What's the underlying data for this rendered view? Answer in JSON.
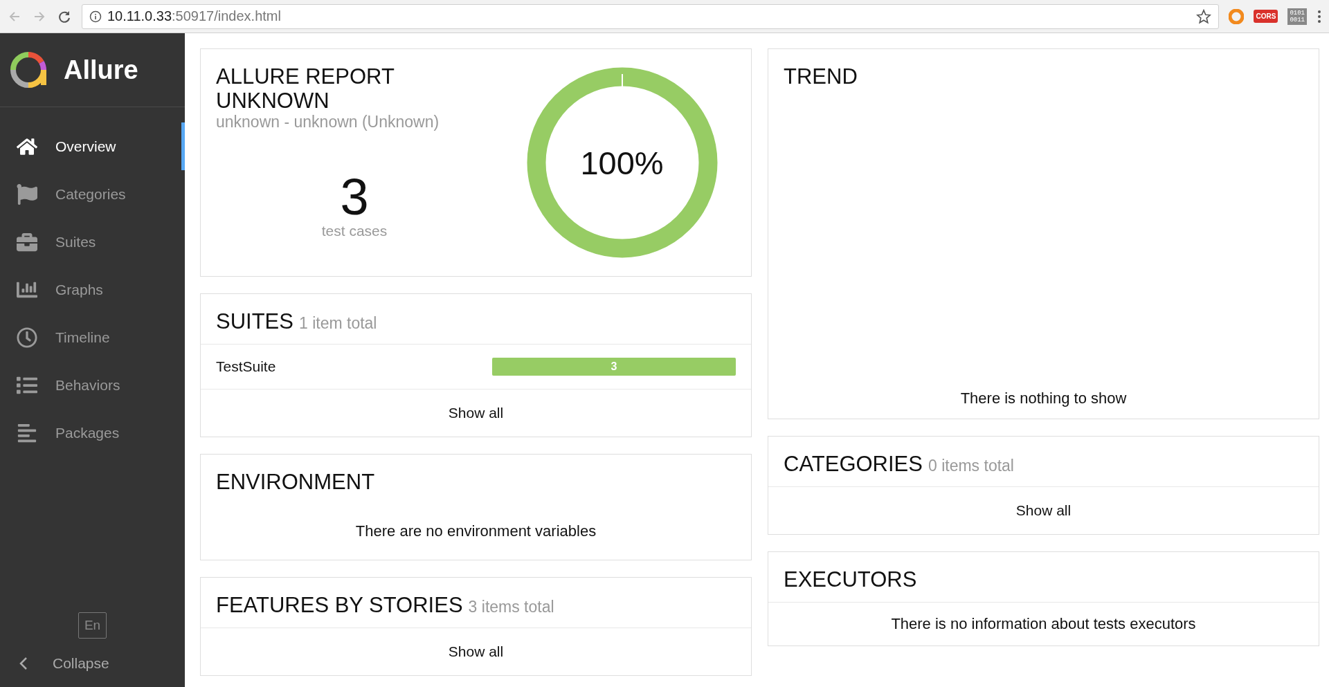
{
  "browser": {
    "url_host": "10.11.0.33",
    "url_path": ":50917/index.html",
    "extensions": [
      {
        "kind": "ring"
      },
      {
        "kind": "badge",
        "label": "CORS"
      },
      {
        "kind": "binary",
        "lines": [
          "0101",
          "0011"
        ]
      }
    ]
  },
  "sidebar": {
    "logo": "Allure",
    "items": [
      {
        "label": "Overview",
        "selected": true
      },
      {
        "label": "Categories",
        "selected": false
      },
      {
        "label": "Suites",
        "selected": false
      },
      {
        "label": "Graphs",
        "selected": false
      },
      {
        "label": "Timeline",
        "selected": false
      },
      {
        "label": "Behaviors",
        "selected": false
      },
      {
        "label": "Packages",
        "selected": false
      }
    ],
    "language": "En",
    "collapse": "Collapse"
  },
  "summary": {
    "title": "ALLURE REPORT UNKNOWN",
    "subtitle": "unknown - unknown (Unknown)",
    "count": "3",
    "count_label": "test cases",
    "percent": "100%"
  },
  "suites": {
    "title": "SUITES",
    "total": "1 item total",
    "rows": [
      {
        "name": "TestSuite",
        "count": "3",
        "level": 1
      }
    ],
    "show_all": "Show all"
  },
  "environment": {
    "title": "ENVIRONMENT",
    "message": "There are no environment variables"
  },
  "features": {
    "title": "FEATURES BY STORIES",
    "total": "3 items total",
    "show_all": "Show all"
  },
  "trend": {
    "title": "TREND",
    "message": "There is nothing to show"
  },
  "categories": {
    "title": "CATEGORIES",
    "total": "0 items total",
    "show_all": "Show all"
  },
  "executors": {
    "title": "EXECUTORS",
    "message": "There is no information about tests executors"
  }
}
